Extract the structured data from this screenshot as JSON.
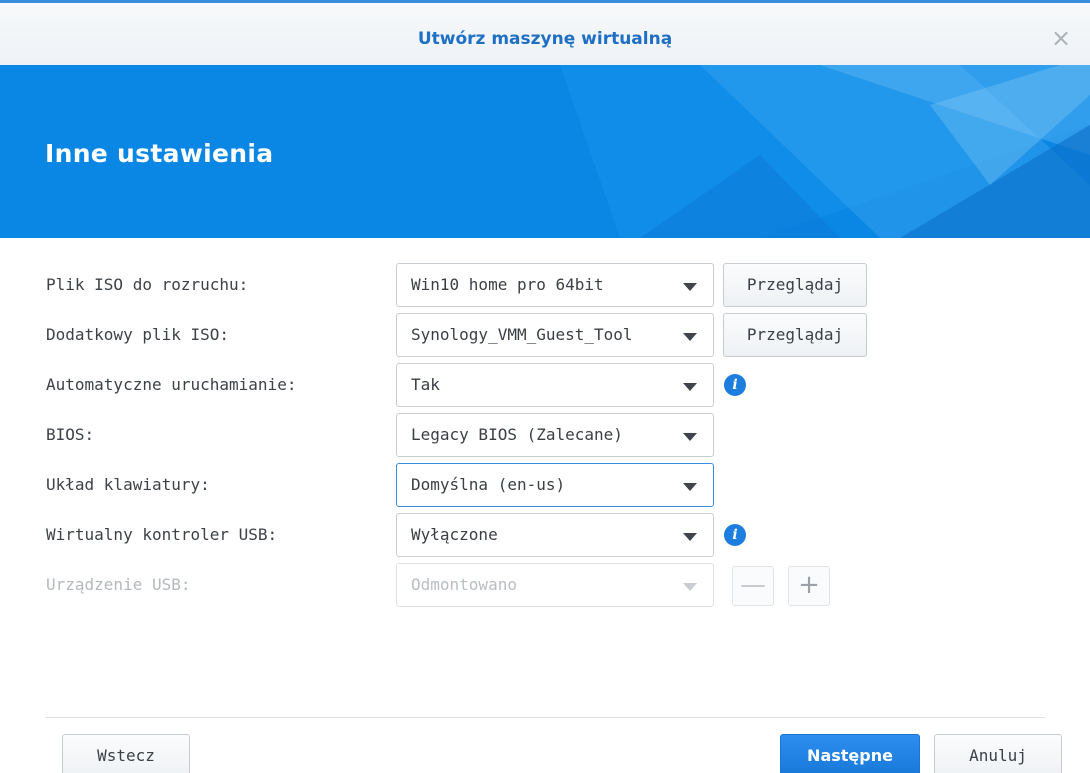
{
  "dialog": {
    "title": "Utwórz maszynę wirtualną",
    "close_glyph": "×"
  },
  "banner": {
    "title": "Inne ustawienia",
    "background_color": "#0a86e4"
  },
  "form": {
    "rows": [
      {
        "label": "Plik ISO do rozruchu:",
        "value": "Win10 home pro 64bit",
        "button": "Przeglądaj"
      },
      {
        "label": "Dodatkowy plik ISO:",
        "value": "Synology_VMM_Guest_Tool",
        "button": "Przeglądaj"
      },
      {
        "label": "Automatyczne uruchamianie:",
        "value": "Tak",
        "info_icon": "i"
      },
      {
        "label": "BIOS:",
        "value": "Legacy BIOS (Zalecane)"
      },
      {
        "label": "Układ klawiatury:",
        "value": "Domyślna (en-us)",
        "focused": true
      },
      {
        "label": "Wirtualny kontroler USB:",
        "value": "Wyłączone",
        "info_icon": "i"
      },
      {
        "label": "Urządzenie USB:",
        "value": "Odmontowano",
        "disabled": true,
        "remove_glyph": "—",
        "add_glyph": "+"
      }
    ]
  },
  "footer": {
    "back_label": "Wstecz",
    "next_label": "Następne",
    "cancel_label": "Anuluj"
  },
  "colors": {
    "accent": "#1f6fc4",
    "primary_button": "#1878d8",
    "info_icon": "#1d7ee0"
  }
}
